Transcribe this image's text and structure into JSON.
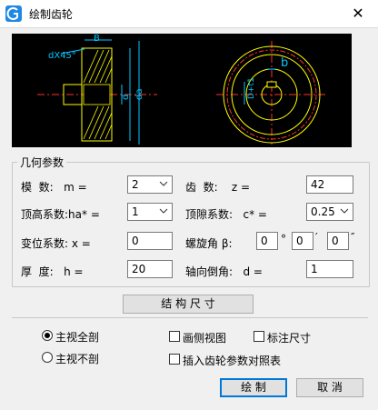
{
  "window": {
    "title": "绘制齿轮",
    "close_glyph": "✕"
  },
  "preview": {
    "labels": {
      "width_b": "B",
      "chamfer": "dX45°",
      "bore_d": "d",
      "tip_da": "da",
      "keyway_b": "b",
      "hub_dt": "D+t1"
    }
  },
  "geometry_group": {
    "title": "几何参数"
  },
  "params": {
    "module": {
      "label": "模  数:   m =",
      "value": "2"
    },
    "teeth": {
      "label": "齿  数:    z =",
      "value": "42"
    },
    "addendum": {
      "label": "顶高系数:ha* =",
      "value": "1"
    },
    "clearance": {
      "label": "顶隙系数:   c* =",
      "value": "0.25"
    },
    "shift": {
      "label": "变位系数: x =",
      "value": "0"
    },
    "helix": {
      "label": "螺旋角 β:",
      "deg": "0",
      "min": "0",
      "sec": "0",
      "deg_unit": "°",
      "min_unit": "′",
      "sec_unit": "″"
    },
    "thickness": {
      "label": "厚  度:   h =",
      "value": "20"
    },
    "chamfer": {
      "label": "轴向倒角:   d =",
      "value": "1"
    }
  },
  "buttons": {
    "structure": "结 构 尺 寸",
    "draw": "绘 制",
    "cancel": "取 消"
  },
  "options": {
    "main_full_section": {
      "label": "主视全剖",
      "checked": true
    },
    "main_no_section": {
      "label": "主视不剖",
      "checked": false
    },
    "draw_side_view": {
      "label": "画侧视图",
      "checked": false
    },
    "mark_dimensions": {
      "label": "标注尺寸",
      "checked": false
    },
    "insert_param_table": {
      "label": "插入齿轮参数对照表",
      "checked": false
    }
  },
  "colors": {
    "accent": "#0078d7",
    "preview_bg": "#000000",
    "dim_color": "#00c8ff",
    "red": "#ff3030"
  }
}
